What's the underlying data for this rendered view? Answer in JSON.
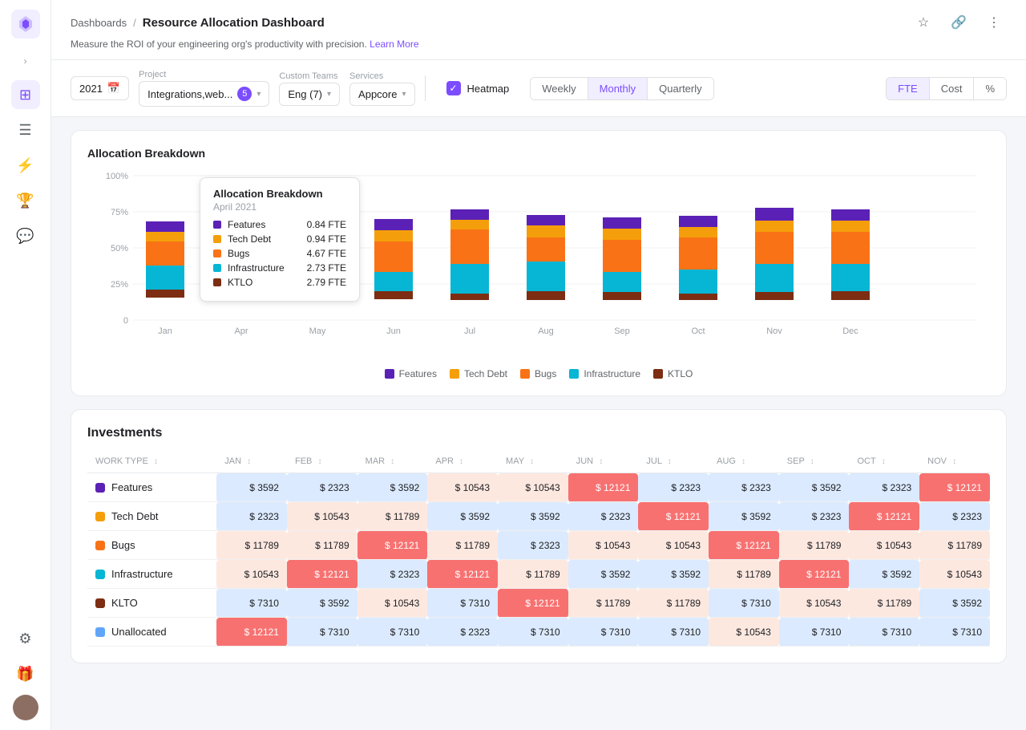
{
  "sidebar": {
    "chevron": "›",
    "icons": [
      "⊞",
      "☰",
      "⚡",
      "🏆",
      "💬",
      "⚙"
    ]
  },
  "header": {
    "breadcrumb_parent": "Dashboards",
    "breadcrumb_separator": "/",
    "title": "Resource Allocation Dashboard",
    "subtitle": "Measure the ROI of your engineering org's productivity with precision.",
    "learn_more": "Learn More"
  },
  "filters": {
    "project_label": "Project",
    "project_value": "Integrations,web...",
    "project_count": "5",
    "teams_label": "Custom Teams",
    "teams_value": "Eng (7)",
    "services_label": "Services",
    "services_value": "Appcore",
    "heatmap_label": "Heatmap",
    "period_buttons": [
      "Weekly",
      "Monthly",
      "Quarterly"
    ],
    "active_period": "Monthly",
    "metric_buttons": [
      "FTE",
      "Cost",
      "%"
    ],
    "active_metric": "FTE"
  },
  "chart": {
    "title": "Allocation Breakdown",
    "y_labels": [
      "100%",
      "75%",
      "50%",
      "25%",
      "0"
    ],
    "months": [
      "Jan",
      "Apr",
      "May",
      "Jun",
      "Jul",
      "Aug",
      "Sep",
      "Oct",
      "Nov",
      "Dec"
    ],
    "legend": [
      {
        "label": "Features",
        "color": "#5b21b6"
      },
      {
        "label": "Tech Debt",
        "color": "#f59e0b"
      },
      {
        "label": "Bugs",
        "color": "#f97316"
      },
      {
        "label": "Infrastructure",
        "color": "#06b6d4"
      },
      {
        "label": "KTLO",
        "color": "#7c2d12"
      }
    ],
    "tooltip": {
      "title": "Allocation Breakdown",
      "date": "April 2021",
      "rows": [
        {
          "label": "Features",
          "value": "0.84 FTE",
          "color": "#5b21b6"
        },
        {
          "label": "Tech Debt",
          "value": "0.94 FTE",
          "color": "#f59e0b"
        },
        {
          "label": "Bugs",
          "value": "4.67 FTE",
          "color": "#f97316"
        },
        {
          "label": "Infrastructure",
          "value": "2.73 FTE",
          "color": "#06b6d4"
        },
        {
          "label": "KTLO",
          "value": "2.79 FTE",
          "color": "#7c2d12"
        }
      ]
    }
  },
  "investments": {
    "title": "Investments",
    "columns": [
      "WORK TYPE",
      "JAN",
      "FEB",
      "MAR",
      "APR",
      "MAY",
      "JUN",
      "JUL",
      "AUG",
      "SEP",
      "OCT",
      "NOV"
    ],
    "rows": [
      {
        "type": "Features",
        "color": "#5b21b6",
        "values": [
          "$ 3592",
          "$ 2323",
          "$ 3592",
          "$ 10543",
          "$ 10543",
          "$ 12121",
          "$ 2323",
          "$ 2323",
          "$ 3592",
          "$ 2323",
          "$ 12121"
        ],
        "classes": [
          "low",
          "low",
          "low",
          "mid",
          "mid",
          "high",
          "low",
          "low",
          "low",
          "low",
          "high"
        ]
      },
      {
        "type": "Tech Debt",
        "color": "#f59e0b",
        "values": [
          "$ 2323",
          "$ 10543",
          "$ 11789",
          "$ 3592",
          "$ 3592",
          "$ 2323",
          "$ 12121",
          "$ 3592",
          "$ 2323",
          "$ 12121",
          "$ 2323"
        ],
        "classes": [
          "low",
          "mid",
          "mid",
          "low",
          "low",
          "low",
          "high",
          "low",
          "low",
          "high",
          "low"
        ]
      },
      {
        "type": "Bugs",
        "color": "#f97316",
        "values": [
          "$ 11789",
          "$ 11789",
          "$ 12121",
          "$ 11789",
          "$ 2323",
          "$ 10543",
          "$ 10543",
          "$ 12121",
          "$ 11789",
          "$ 10543",
          "$ 11789"
        ],
        "classes": [
          "mid",
          "mid",
          "high",
          "mid",
          "low",
          "mid",
          "mid",
          "high",
          "mid",
          "mid",
          "mid"
        ]
      },
      {
        "type": "Infrastructure",
        "color": "#06b6d4",
        "values": [
          "$ 10543",
          "$ 12121",
          "$ 2323",
          "$ 12121",
          "$ 11789",
          "$ 3592",
          "$ 3592",
          "$ 11789",
          "$ 12121",
          "$ 3592",
          "$ 10543"
        ],
        "classes": [
          "mid",
          "high",
          "low",
          "high",
          "mid",
          "low",
          "low",
          "mid",
          "high",
          "low",
          "mid"
        ]
      },
      {
        "type": "KLTO",
        "color": "#7c2d12",
        "values": [
          "$ 7310",
          "$ 3592",
          "$ 10543",
          "$ 7310",
          "$ 12121",
          "$ 11789",
          "$ 11789",
          "$ 7310",
          "$ 10543",
          "$ 11789",
          "$ 3592"
        ],
        "classes": [
          "low",
          "low",
          "mid",
          "low",
          "high",
          "mid",
          "mid",
          "low",
          "mid",
          "mid",
          "low"
        ]
      },
      {
        "type": "Unallocated",
        "color": "#60a5fa",
        "values": [
          "$ 12121",
          "$ 7310",
          "$ 7310",
          "$ 2323",
          "$ 7310",
          "$ 7310",
          "$ 7310",
          "$ 10543",
          "$ 7310",
          "$ 7310",
          "$ 7310"
        ],
        "classes": [
          "high",
          "low",
          "low",
          "low",
          "low",
          "low",
          "low",
          "mid",
          "low",
          "low",
          "low"
        ]
      }
    ]
  }
}
